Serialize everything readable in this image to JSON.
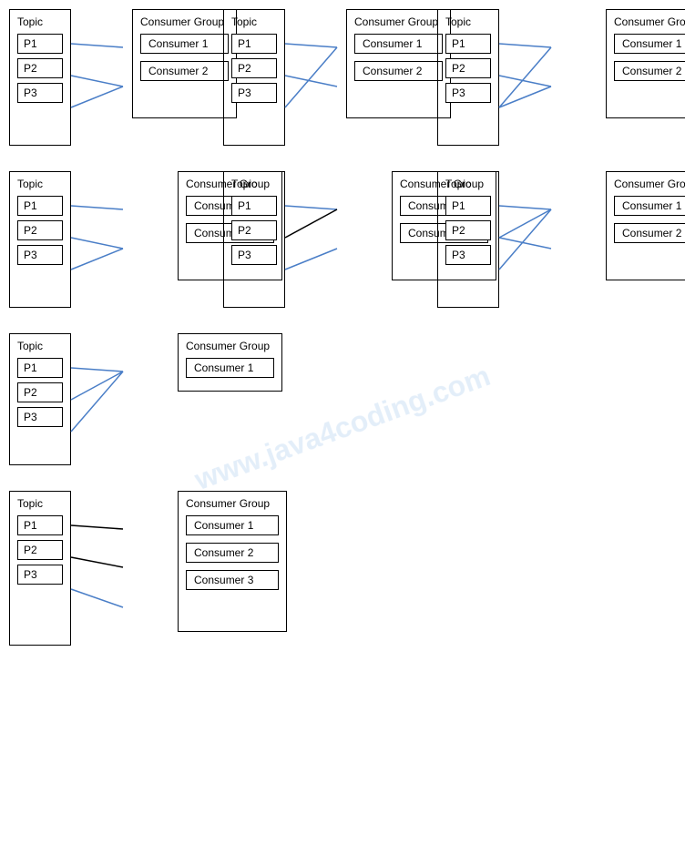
{
  "watermark": "www.java4coding.com",
  "rows": [
    {
      "diagrams": [
        {
          "id": "d1",
          "topic_label": "Topic",
          "partitions": [
            "P1",
            "P2",
            "P3"
          ],
          "group_label": "Consumer Group",
          "consumers": [
            "Consumer 1",
            "Consumer 2"
          ],
          "connections": [
            [
              0,
              0
            ],
            [
              1,
              1
            ],
            [
              2,
              1
            ]
          ],
          "type": "basic"
        },
        {
          "id": "d2",
          "topic_label": "Topic",
          "partitions": [
            "P1",
            "P2",
            "P3"
          ],
          "group_label": "Consumer Group",
          "consumers": [
            "Consumer 1",
            "Consumer 2"
          ],
          "connections": [
            [
              0,
              0
            ],
            [
              1,
              0
            ],
            [
              2,
              1
            ]
          ],
          "type": "cross1"
        },
        {
          "id": "d3",
          "topic_label": "Topic",
          "partitions": [
            "P1",
            "P2",
            "P3"
          ],
          "group_label": "Consumer Group",
          "consumers": [
            "Consumer 1",
            "Consumer 2"
          ],
          "connections": [
            [
              0,
              0
            ],
            [
              1,
              1
            ],
            [
              2,
              0
            ],
            [
              2,
              1
            ]
          ],
          "type": "cross2"
        }
      ]
    },
    {
      "diagrams": [
        {
          "id": "d4",
          "topic_label": "Topic",
          "partitions": [
            "P1",
            "P2",
            "P3"
          ],
          "group_label": "Consumer Group",
          "consumers": [
            "Consumer 1",
            "Consumer 2"
          ],
          "connections": [
            [
              0,
              0
            ],
            [
              1,
              1
            ],
            [
              2,
              1
            ]
          ],
          "type": "basic"
        },
        {
          "id": "d5",
          "topic_label": "Topic",
          "partitions": [
            "P1",
            "P2",
            "P3"
          ],
          "group_label": "Consumer Group",
          "consumers": [
            "Consumer 1",
            "Consumer 2"
          ],
          "connections": [
            [
              0,
              0
            ],
            [
              1,
              0
            ],
            [
              2,
              1
            ]
          ],
          "type": "cross1"
        },
        {
          "id": "d6",
          "topic_label": "Topic",
          "partitions": [
            "P1",
            "P2",
            "P3"
          ],
          "group_label": "Consumer Group",
          "consumers": [
            "Consumer 1",
            "Consumer 2"
          ],
          "connections": [
            [
              0,
              0
            ],
            [
              1,
              1
            ],
            [
              2,
              0
            ],
            [
              1,
              1
            ]
          ],
          "type": "cross3"
        }
      ]
    },
    {
      "diagrams": [
        {
          "id": "d7",
          "topic_label": "Topic",
          "partitions": [
            "P1",
            "P2",
            "P3"
          ],
          "group_label": "Consumer Group",
          "consumers": [
            "Consumer 1"
          ],
          "connections": [
            [
              0,
              0
            ],
            [
              1,
              0
            ],
            [
              2,
              0
            ]
          ],
          "type": "all-one"
        }
      ]
    },
    {
      "diagrams": [
        {
          "id": "d8",
          "topic_label": "Topic",
          "partitions": [
            "P1",
            "P2",
            "P3"
          ],
          "group_label": "Consumer Group",
          "consumers": [
            "Consumer 1",
            "Consumer 2",
            "Consumer 3"
          ],
          "connections": [
            [
              0,
              0
            ],
            [
              1,
              1
            ],
            [
              2,
              2
            ]
          ],
          "type": "one-each"
        }
      ]
    }
  ]
}
